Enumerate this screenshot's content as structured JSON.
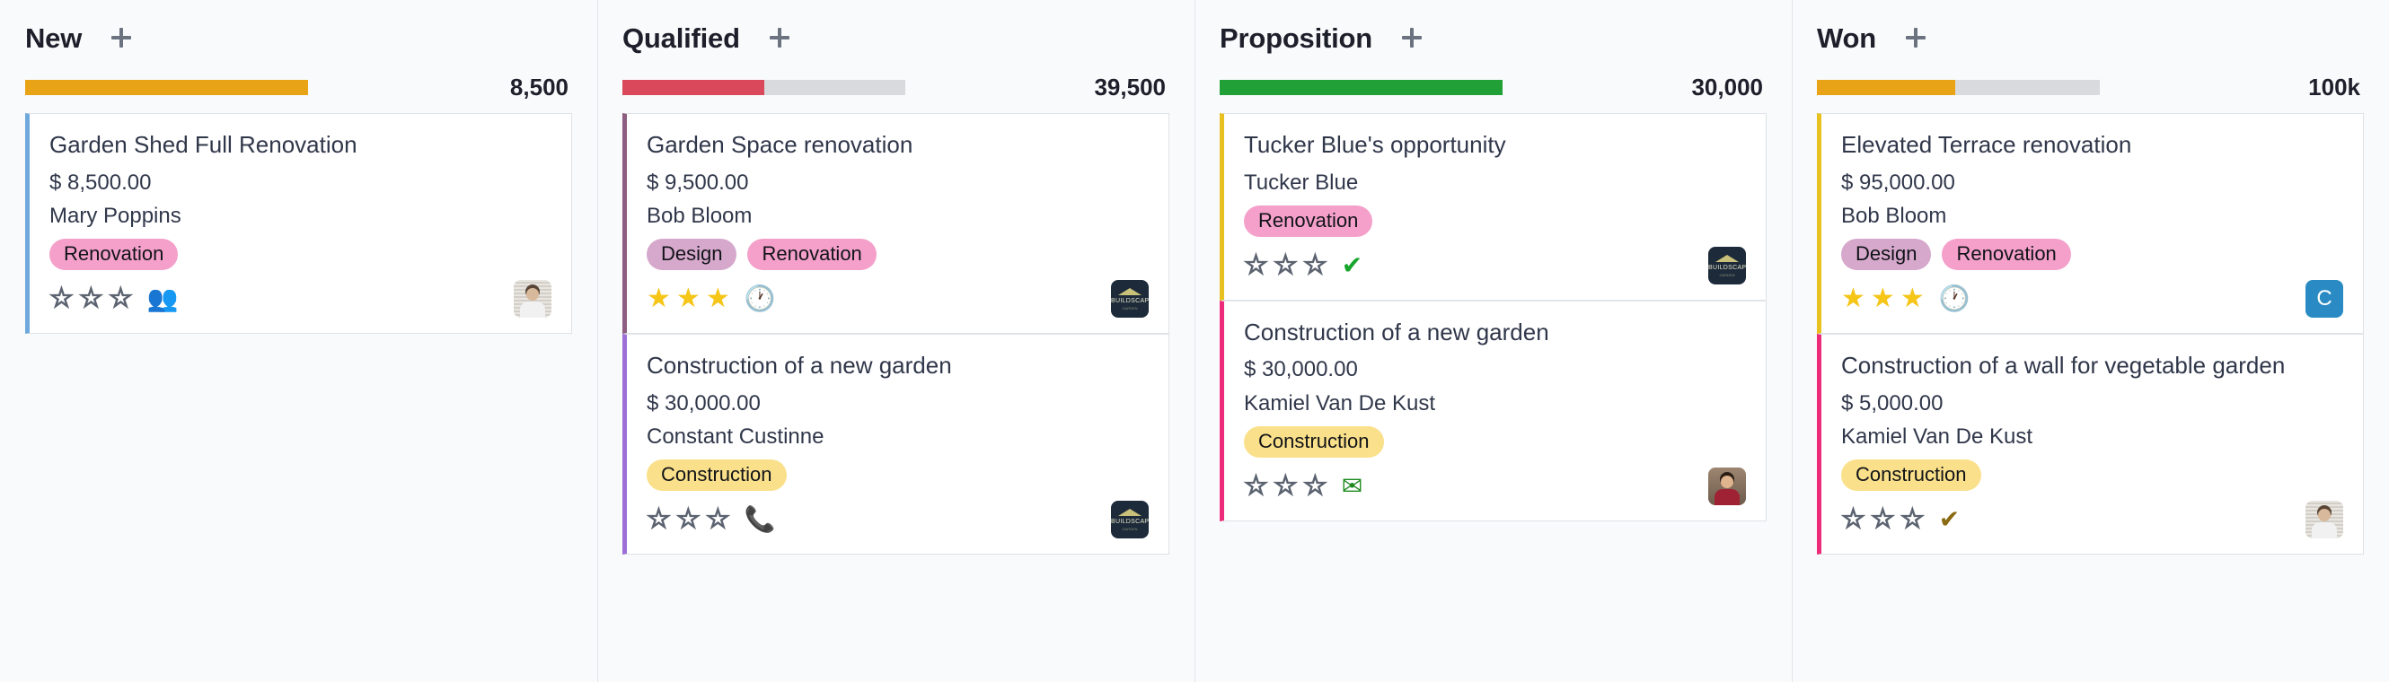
{
  "board": {
    "columns": [
      {
        "title": "New",
        "add_label": "+",
        "progress": {
          "percent": 100,
          "color": "#E8A317",
          "amount": "8,500"
        },
        "cards": [
          {
            "title": "Garden Shed Full Renovation",
            "amount": "$ 8,500.00",
            "person": "Mary Poppins",
            "accent": "#6EA8DC",
            "tags": [
              {
                "label": "Renovation",
                "color": "#F4A0CA"
              }
            ],
            "rating": 0,
            "activity_icon": "users-icon",
            "activity_glyph": "👥",
            "activity_color": "#B8860B",
            "avatar": {
              "type": "photo",
              "style": "blinds",
              "skin": "#D9B99B",
              "shirt": "#F1F1F1",
              "hair": "#5A4636"
            }
          }
        ]
      },
      {
        "title": "Qualified",
        "add_label": "+",
        "progress": {
          "percent": 50,
          "color": "#D9485B",
          "amount": "39,500"
        },
        "cards": [
          {
            "title": "Garden Space renovation",
            "amount": "$ 9,500.00",
            "person": "Bob Bloom",
            "accent": "#8E5E82",
            "tags": [
              {
                "label": "Design",
                "color": "#D6A8CC"
              },
              {
                "label": "Renovation",
                "color": "#F4A0CA"
              }
            ],
            "rating": 3,
            "activity_icon": "clock-icon",
            "activity_glyph": "🕐",
            "activity_color": "#3C4352",
            "avatar": {
              "type": "logo",
              "label": "BUILDSCAPE",
              "sub": "GARDEN"
            }
          },
          {
            "title": "Construction of a new garden",
            "amount": "$ 30,000.00",
            "person": "Constant Custinne",
            "accent": "#9C6FD6",
            "tags": [
              {
                "label": "Construction",
                "color": "#FAE08A"
              }
            ],
            "rating": 0,
            "activity_icon": "phone-icon",
            "activity_glyph": "📞",
            "activity_color": "#E03E3E",
            "avatar": {
              "type": "logo",
              "label": "BUILDSCAPE",
              "sub": "GARDEN"
            }
          }
        ]
      },
      {
        "title": "Proposition",
        "add_label": "+",
        "progress": {
          "percent": 100,
          "color": "#21A038",
          "amount": "30,000"
        },
        "cards": [
          {
            "title": "Tucker Blue's opportunity",
            "amount": "",
            "person": "Tucker Blue",
            "accent": "#E8C020",
            "tags": [
              {
                "label": "Renovation",
                "color": "#F4A0CA"
              }
            ],
            "rating": 0,
            "activity_icon": "check-icon",
            "activity_glyph": "✔",
            "activity_color": "#18A52C",
            "avatar": {
              "type": "logo",
              "label": "BUILDSCAPE",
              "sub": "GARDEN"
            }
          },
          {
            "title": "Construction of a new garden",
            "amount": "$ 30,000.00",
            "person": "Kamiel Van De Kust",
            "accent": "#EC2C7A",
            "tags": [
              {
                "label": "Construction",
                "color": "#FAE08A"
              }
            ],
            "rating": 0,
            "activity_icon": "envelope-icon",
            "activity_glyph": "✉",
            "activity_color": "#1E8A1E",
            "avatar": {
              "type": "photo",
              "style": "cafe",
              "skin": "#E0B48E",
              "shirt": "#9E2233",
              "hair": "#2B1D16"
            }
          }
        ]
      },
      {
        "title": "Won",
        "add_label": "+",
        "progress": {
          "percent": 49,
          "color": "#E8A317",
          "amount": "100k"
        },
        "cards": [
          {
            "title": "Elevated Terrace renovation",
            "amount": "$ 95,000.00",
            "person": "Bob Bloom",
            "accent": "#E8C020",
            "tags": [
              {
                "label": "Design",
                "color": "#D6A8CC"
              },
              {
                "label": "Renovation",
                "color": "#F4A0CA"
              }
            ],
            "rating": 3,
            "activity_icon": "clock-icon",
            "activity_glyph": "🕐",
            "activity_color": "#3C4352",
            "avatar": {
              "type": "initial",
              "initial": "C",
              "color": "#2A8BC4"
            }
          },
          {
            "title": "Construction of a wall for vegetable garden",
            "amount": "$ 5,000.00",
            "person": "Kamiel Van De Kust",
            "accent": "#EC2C7A",
            "tags": [
              {
                "label": "Construction",
                "color": "#FAE08A"
              }
            ],
            "rating": 0,
            "activity_icon": "check-icon",
            "activity_glyph": "✔",
            "activity_color": "#8A6A12",
            "avatar": {
              "type": "photo",
              "style": "blinds",
              "skin": "#D9B99B",
              "shirt": "#F1F1F1",
              "hair": "#5A4636"
            }
          }
        ]
      }
    ]
  }
}
